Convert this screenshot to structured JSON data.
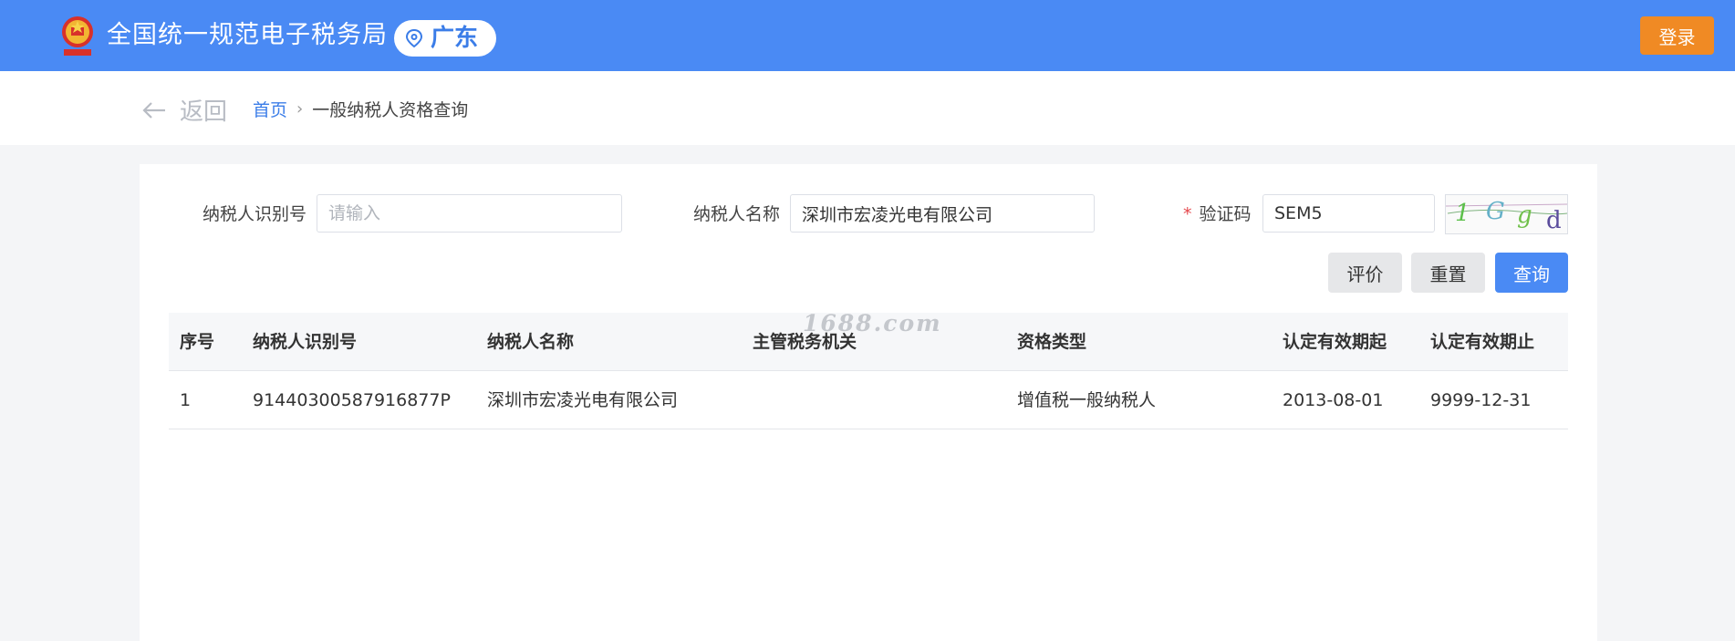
{
  "header": {
    "site_title": "全国统一规范电子税务局",
    "region": "广东",
    "login_label": "登录",
    "emblem_text": "国家税务总局"
  },
  "nav": {
    "back_label": "返回",
    "breadcrumb_home": "首页",
    "breadcrumb_sep": "›",
    "breadcrumb_current": "一般纳税人资格查询"
  },
  "form": {
    "taxpayer_id_label": "纳税人识别号",
    "taxpayer_id_value": "",
    "taxpayer_id_placeholder": "请输入",
    "taxpayer_name_label": "纳税人名称",
    "taxpayer_name_value": "深圳市宏凌光电有限公司",
    "required_mark": "*",
    "captcha_label": "验证码",
    "captcha_value": "SEM5",
    "captcha_image_text": "1Ggd"
  },
  "actions": {
    "evaluate_label": "评价",
    "reset_label": "重置",
    "query_label": "查询"
  },
  "table": {
    "columns": [
      "序号",
      "纳税人识别号",
      "纳税人名称",
      "主管税务机关",
      "资格类型",
      "认定有效期起",
      "认定有效期止"
    ],
    "rows": [
      [
        "1",
        "91440300587916877P",
        "深圳市宏凌光电有限公司",
        "",
        "增值税一般纳税人",
        "2013-08-01",
        "9999-12-31"
      ]
    ]
  },
  "watermark": "1688.com",
  "colors": {
    "header_bg": "#4a8af4",
    "login_bg": "#f08a24",
    "link": "#3b7de8",
    "required": "#e5484d"
  }
}
